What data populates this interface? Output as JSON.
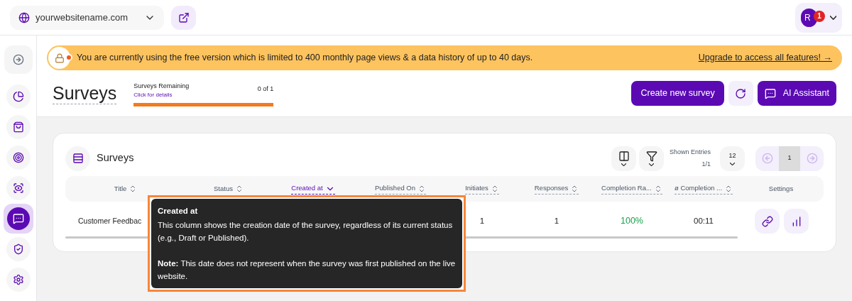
{
  "header": {
    "site": "yourwebsitename.com",
    "user": {
      "initials": "R",
      "notifications": "1"
    }
  },
  "sidebar": {
    "items": [
      {
        "selected": false
      },
      {
        "selected": false
      },
      {
        "selected": false
      },
      {
        "selected": false
      },
      {
        "selected": true
      },
      {
        "selected": false
      },
      {
        "selected": false
      }
    ]
  },
  "banner": {
    "text": "You are currently using the free version which is limited to 400 monthly page views & a data history of up to 40 days.",
    "link": "Upgrade to access all features! →"
  },
  "page": {
    "title": "Surveys",
    "quota": {
      "label": "Surveys Remaining",
      "link": "Click for details",
      "reading": "0 of 1",
      "level": 1
    },
    "buttons": [
      "Create new survey",
      "AI Assistant"
    ]
  },
  "card": {
    "title": "Surveys",
    "shown_entries": {
      "label": "Shown Entries",
      "value": "1/1"
    },
    "page_size": "12",
    "pagination": {
      "pages": [
        {
          "label": "1",
          "selected": true
        }
      ]
    },
    "table": {
      "columns": [
        {
          "label": "Title",
          "sortable": true,
          "selected": false
        },
        {
          "label": "Status",
          "sortable": true,
          "selected": false
        },
        {
          "label": "Created at",
          "sortable": true,
          "selected": true
        },
        {
          "label": "Published On",
          "sortable": true,
          "selected": false
        },
        {
          "label": "Initiates",
          "sortable": true,
          "selected": false
        },
        {
          "label": "Responses",
          "sortable": true,
          "selected": false
        },
        {
          "label": "Completion Ra...",
          "sortable": true,
          "selected": false
        },
        {
          "label": "ø Completion ...",
          "sortable": true,
          "selected": false
        },
        {
          "label": "Settings",
          "sortable": false,
          "selected": false
        }
      ],
      "rows": [
        {
          "title": "Customer Feedbac",
          "initiates": "1",
          "responses": "1",
          "completion_rate": "100%",
          "completion_time": "00:11"
        }
      ]
    }
  },
  "tooltip": {
    "title": "Created at",
    "body": "This column shows the creation date of the survey, regardless of its current status (e.g., Draft or Published).",
    "note": "**Note:** This date does not represent when the survey was first published on the live website."
  }
}
